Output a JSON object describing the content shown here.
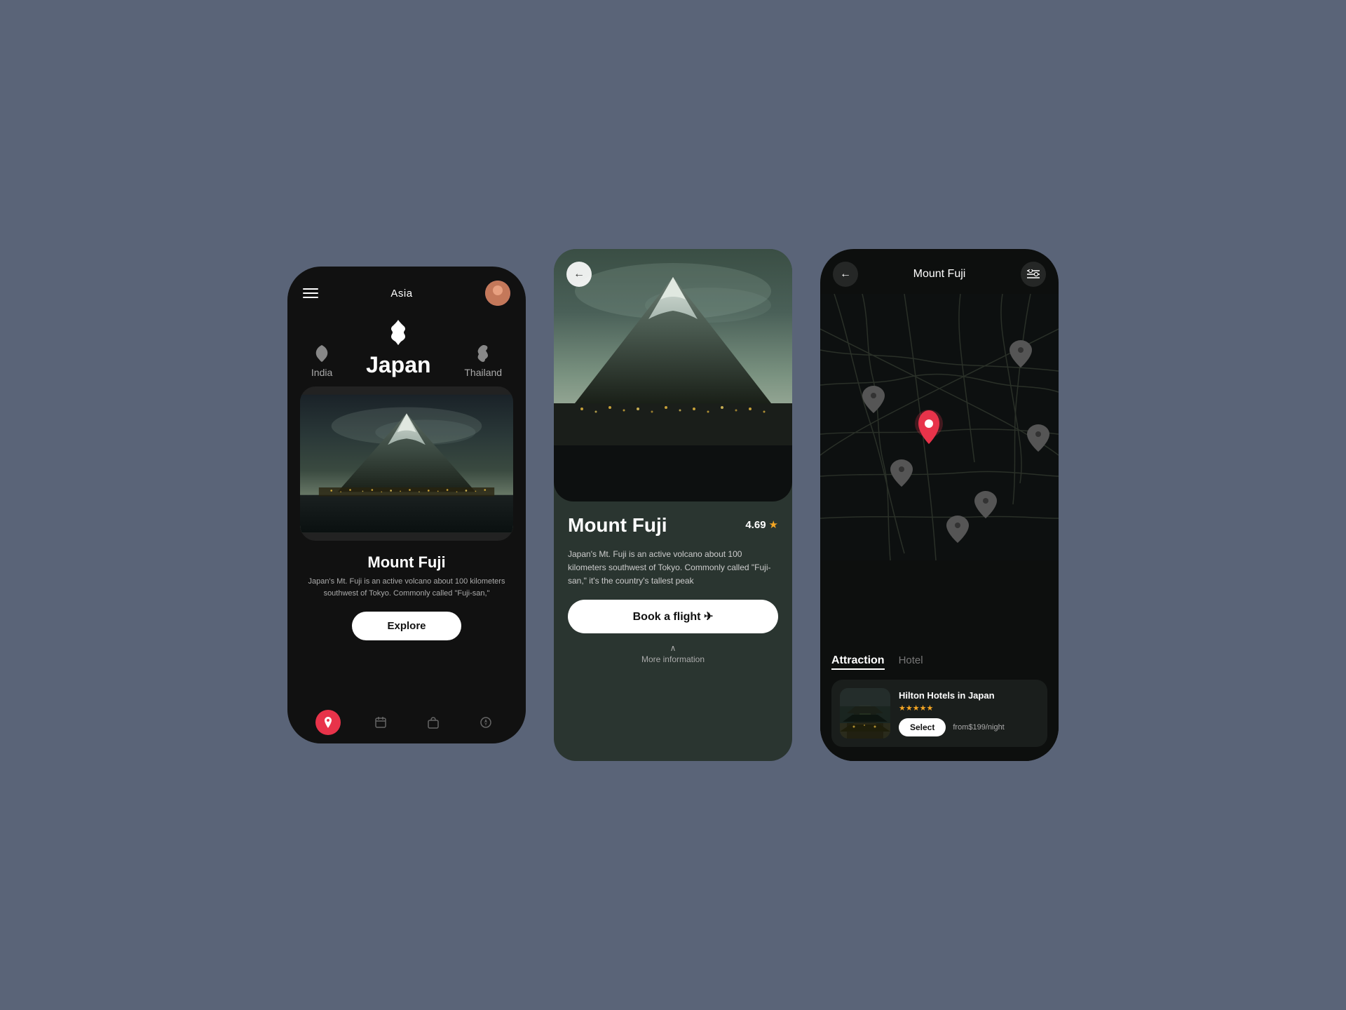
{
  "bg_color": "#5a6478",
  "phone1": {
    "header": {
      "title": "Asia",
      "avatar_label": "User"
    },
    "countries": [
      {
        "name": "India",
        "active": false
      },
      {
        "name": "Japan",
        "active": true
      },
      {
        "name": "Thailand",
        "active": false
      }
    ],
    "card": {
      "title": "Mount Fuji",
      "description": "Japan's Mt. Fuji is an active volcano about 100 kilometers southwest of Tokyo. Commonly called \"Fuji-san,\"",
      "explore_btn": "Explore"
    },
    "nav_icons": [
      "location",
      "calendar",
      "bag",
      "compass"
    ]
  },
  "phone2": {
    "back_label": "←",
    "card": {
      "title": "Mount Fuji",
      "rating": "4.69",
      "description": "Japan's Mt. Fuji is an active volcano about 100 kilometers southwest of Tokyo. Commonly called \"Fuji-san,\" it's the country's tallest peak",
      "book_btn": "Book a flight ✈",
      "more_info": "More information"
    }
  },
  "phone3": {
    "back_label": "←",
    "title": "Mount Fuji",
    "filter_icon": "⊟",
    "section": {
      "tabs": [
        {
          "label": "Attraction",
          "active": true
        },
        {
          "label": "Hotel",
          "active": false
        }
      ]
    },
    "hotel": {
      "name": "Hilton Hotels in Japan",
      "stars": "★★★★★",
      "select_btn": "Select",
      "price": "from$199/night"
    }
  }
}
